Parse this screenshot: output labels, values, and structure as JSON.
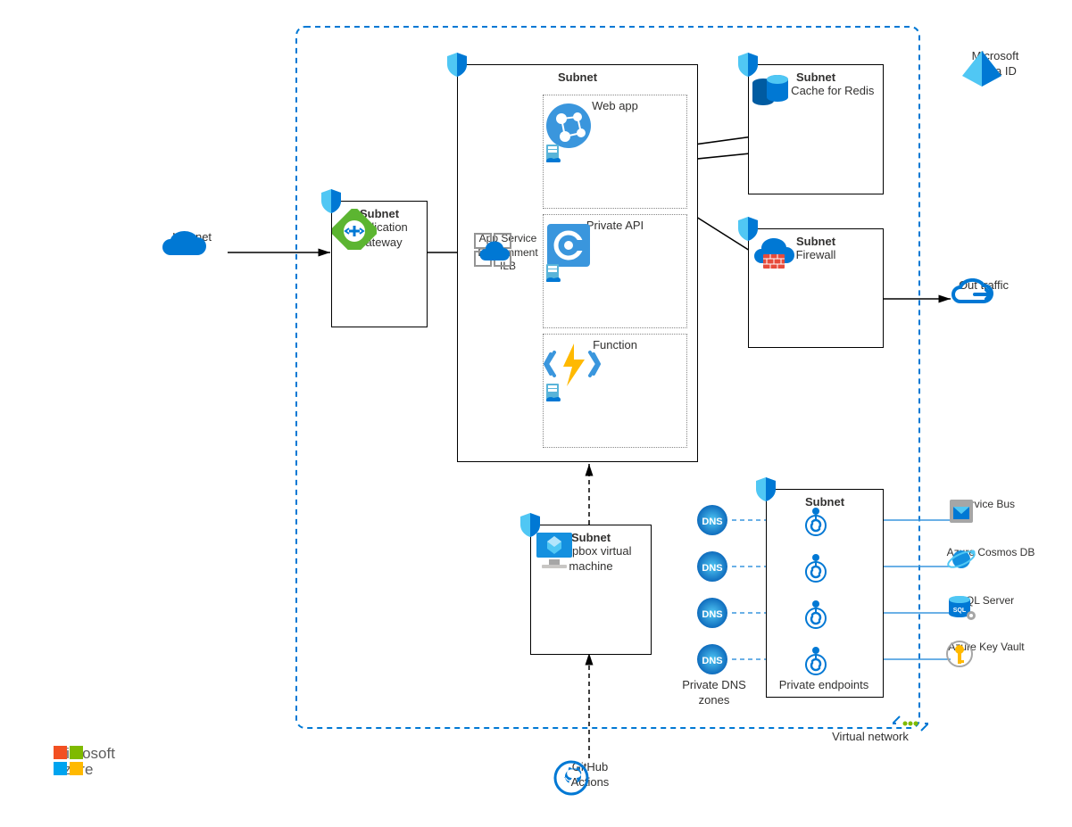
{
  "labels": {
    "internet": "Internet",
    "appGateway": "Application Gateway",
    "subnet": "Subnet",
    "ase": "App Service Environment ILB",
    "webApp": "Web app",
    "privateApi": "Private API",
    "function": "Function",
    "redis": "Azure Cache for Redis",
    "firewall": "Firewall",
    "outTraffic": "Out traffic",
    "jumpbox": "Jumpbox virtual machine",
    "githubActions": "GitHub Actions",
    "privateDnsZones": "Private DNS zones",
    "privateEndpoints": "Private endpoints",
    "serviceBus": "Service Bus",
    "cosmosDb": "Azure Cosmos DB",
    "sqlServer": "SQL Server",
    "keyVault": "Azure Key Vault",
    "virtualNetwork": "Virtual network",
    "entraId": "Microsoft Entra ID",
    "msAzureTop": "Microsoft",
    "msAzureBottom": "Azure",
    "dns": "DNS"
  },
  "colors": {
    "azureBlue": "#0078D4",
    "lightBlue": "#50C7F4",
    "vnBorder": "#0078D4",
    "gatewayGreen": "#5CB531",
    "functionYellow": "#FFB900",
    "redisBlue": "#005BA1",
    "keyVaultYellow": "#FFB900"
  },
  "diagram": {
    "type": "azure-architecture",
    "boundary": "Virtual network",
    "externalComponents": [
      "Internet",
      "Microsoft Entra ID",
      "Out traffic",
      "Service Bus",
      "Azure Cosmos DB",
      "SQL Server",
      "Azure Key Vault",
      "GitHub Actions"
    ],
    "subnets": [
      {
        "name": "Application Gateway subnet",
        "contains": [
          "Application Gateway"
        ]
      },
      {
        "name": "App Service Environment subnet",
        "contains": [
          "App Service Environment ILB",
          "Web app",
          "Private API",
          "Function"
        ]
      },
      {
        "name": "Azure Cache for Redis subnet",
        "contains": [
          "Azure Cache for Redis"
        ]
      },
      {
        "name": "Firewall subnet",
        "contains": [
          "Firewall"
        ]
      },
      {
        "name": "Jumpbox subnet",
        "contains": [
          "Jumpbox virtual machine"
        ]
      },
      {
        "name": "Private endpoints subnet",
        "contains": [
          "Private endpoints x4"
        ]
      }
    ],
    "flows": [
      {
        "from": "Internet",
        "to": "Application Gateway",
        "style": "solid-arrow"
      },
      {
        "from": "Application Gateway",
        "to": "App Service Environment ILB",
        "style": "solid-arrow"
      },
      {
        "from": "App Service Environment ILB",
        "to": "Web app",
        "style": "solid-arrow"
      },
      {
        "from": "Web app",
        "to": "Azure Cache for Redis",
        "style": "solid-arrow-bidirectional"
      },
      {
        "from": "Firewall",
        "to": "Web app",
        "style": "solid-arrow"
      },
      {
        "from": "Firewall",
        "to": "Out traffic",
        "style": "solid-arrow"
      },
      {
        "from": "GitHub Actions",
        "to": "Jumpbox virtual machine",
        "style": "dashed-arrow"
      },
      {
        "from": "Jumpbox virtual machine",
        "to": "App Service Environment subnet",
        "style": "dashed-arrow"
      },
      {
        "from": "Private DNS zones",
        "to": "Private endpoints",
        "style": "dashed",
        "count": 4
      },
      {
        "from": "Private endpoints",
        "to": "Service Bus",
        "style": "solid"
      },
      {
        "from": "Private endpoints",
        "to": "Azure Cosmos DB",
        "style": "solid"
      },
      {
        "from": "Private endpoints",
        "to": "SQL Server",
        "style": "solid"
      },
      {
        "from": "Private endpoints",
        "to": "Azure Key Vault",
        "style": "solid"
      }
    ]
  }
}
